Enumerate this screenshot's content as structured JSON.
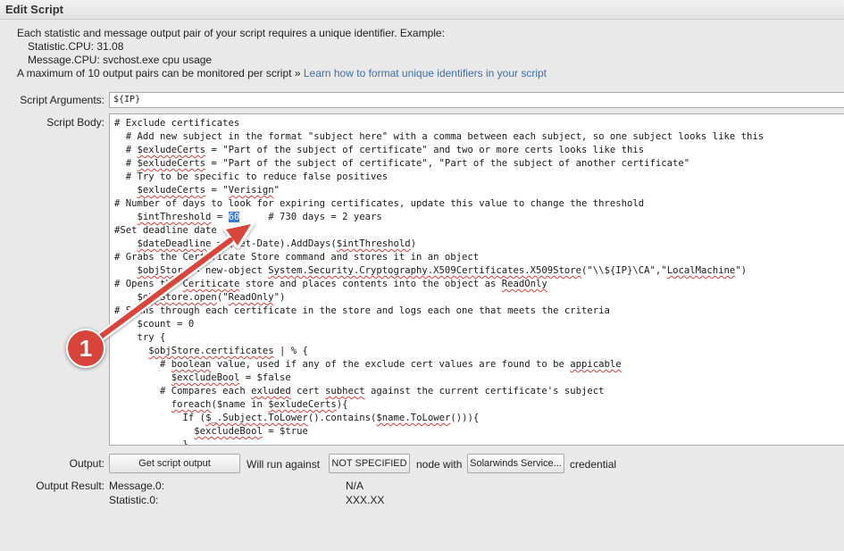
{
  "header": {
    "title": "Edit Script"
  },
  "intro": {
    "line1": "Each statistic and message output pair of your script requires a unique identifier. Example:",
    "example_stat": "Statistic.CPU: 31.08",
    "example_msg": "Message.CPU: svchost.exe cpu usage",
    "line4": "A maximum of 10 output pairs can be monitored per script",
    "link_prefix": "»",
    "link": "Learn how to format unique identifiers in your script"
  },
  "args": {
    "label": "Script Arguments:",
    "value": "${IP}"
  },
  "body": {
    "label": "Script Body:",
    "lines": [
      [
        {
          "t": "# Exclude certificates"
        }
      ],
      [
        {
          "t": "  # Add new subject in the format \"subject here\" with a comma between each subject, so one subject looks like this"
        }
      ],
      [
        {
          "t": "  # "
        },
        {
          "t": "$exludeCerts",
          "s": 1
        },
        {
          "t": " = \"Part of the subject of certificate\" and two or more certs looks like this"
        }
      ],
      [
        {
          "t": "  # "
        },
        {
          "t": "$exludeCerts",
          "s": 1
        },
        {
          "t": " = \"Part of the subject of certificate\", \"Part of the subject of another certificate\""
        }
      ],
      [
        {
          "t": "  # Try to be specific to reduce false positives"
        }
      ],
      [
        {
          "t": "    "
        },
        {
          "t": "$exludeCerts",
          "s": 1
        },
        {
          "t": " = \""
        },
        {
          "t": "Verisign",
          "s": 1
        },
        {
          "t": "\""
        }
      ],
      [
        {
          "t": "# Number of days to look for expiring certificates, update this value to change the threshold"
        }
      ],
      [
        {
          "t": "    "
        },
        {
          "t": "$intThreshold",
          "s": 1
        },
        {
          "t": " = "
        },
        {
          "t": "60",
          "h": 1
        },
        {
          "t": "     # 730 days = 2 years"
        }
      ],
      [
        {
          "t": "#Set deadline date"
        }
      ],
      [
        {
          "t": "    "
        },
        {
          "t": "$dateDeadline",
          "s": 1
        },
        {
          "t": " = (Get-Date).AddDays("
        },
        {
          "t": "$intThreshold",
          "s": 1
        },
        {
          "t": ")"
        }
      ],
      [
        {
          "t": "# Grabs the Certificate Store command and stores it in an object"
        }
      ],
      [
        {
          "t": "    "
        },
        {
          "t": "$objStore",
          "s": 1
        },
        {
          "t": " = new-object "
        },
        {
          "t": "System.Security.Cryptography.X509Certificates.X509Store",
          "s": 1
        },
        {
          "t": "(\"\\\\${IP}\\CA\",\""
        },
        {
          "t": "LocalMachine",
          "s": 1
        },
        {
          "t": "\")"
        }
      ],
      [
        {
          "t": "# Opens the "
        },
        {
          "t": "Ceriticate",
          "s": 1
        },
        {
          "t": " store and places contents into the object as "
        },
        {
          "t": "ReadOnly",
          "s": 1
        }
      ],
      [
        {
          "t": "    "
        },
        {
          "t": "$objStore.open",
          "s": 1
        },
        {
          "t": "(\""
        },
        {
          "t": "ReadOnly",
          "s": 1
        },
        {
          "t": "\")"
        }
      ],
      [
        {
          "t": "# Scans through each certificate in the store and logs each one that meets the criteria"
        }
      ],
      [
        {
          "t": "    $count = 0"
        }
      ],
      [
        {
          "t": "    try {"
        }
      ],
      [
        {
          "t": "      "
        },
        {
          "t": "$objStore.certificates",
          "s": 1
        },
        {
          "t": " | % {"
        }
      ],
      [
        {
          "t": "        # "
        },
        {
          "t": "boolean",
          "s": 1
        },
        {
          "t": " value, used if any of the exclude cert values are found to be "
        },
        {
          "t": "appicable",
          "s": 1
        }
      ],
      [
        {
          "t": "          "
        },
        {
          "t": "$excludeBool",
          "s": 1
        },
        {
          "t": " = $false"
        }
      ],
      [
        {
          "t": "        # Compares each "
        },
        {
          "t": "exluded",
          "s": 1
        },
        {
          "t": " cert "
        },
        {
          "t": "subhect",
          "s": 1
        },
        {
          "t": " against the current certificate's subject"
        }
      ],
      [
        {
          "t": "          "
        },
        {
          "t": "foreach",
          "s": 1
        },
        {
          "t": "($name in "
        },
        {
          "t": "$exludeCerts",
          "s": 1
        },
        {
          "t": "){"
        }
      ],
      [
        {
          "t": "            If ("
        },
        {
          "t": "$_.Subject.ToLower",
          "s": 1
        },
        {
          "t": "().contains("
        },
        {
          "t": "$name.ToLower",
          "s": 1
        },
        {
          "t": "())){"
        }
      ],
      [
        {
          "t": "              "
        },
        {
          "t": "$excludeBool",
          "s": 1
        },
        {
          "t": " = $true"
        }
      ],
      [
        {
          "t": "            }"
        }
      ]
    ]
  },
  "output": {
    "label": "Output:",
    "get_button": "Get script output",
    "will_run": "Will run against",
    "node_button": "NOT SPECIFIED",
    "node_with": "node with",
    "cred_button": "Solarwinds Service...",
    "credential": "credential"
  },
  "result": {
    "label": "Output Result:",
    "rows": [
      {
        "name": "Message.0:",
        "value": "N/A"
      },
      {
        "name": "Statistic.0:",
        "value": "XXX.XX"
      }
    ]
  },
  "callout": {
    "number": "1"
  },
  "colors": {
    "link": "#3e6fa6",
    "callout": "#d7443a",
    "selection": "#3b78d8",
    "spellcheck": "#e03c3c"
  }
}
